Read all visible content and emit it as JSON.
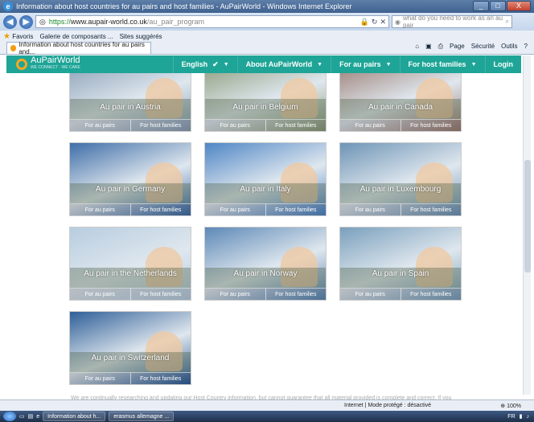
{
  "window": {
    "title": "Information about host countries for au pairs and host families - AuPairWorld - Windows Internet Explorer",
    "buttons": [
      "_",
      "□",
      "X"
    ]
  },
  "addressbar": {
    "https": "https://",
    "host": "www.aupair-world.co.uk",
    "path": "/au_pair_program",
    "search_placeholder": "what do you need to work as an au pair"
  },
  "favorites": {
    "label": "Favoris",
    "items": [
      "Galerie de composants ...",
      "Sites suggérés"
    ]
  },
  "tab": {
    "label": "Information about host countries for au pairs and...",
    "commands": [
      "Page",
      "Sécurité",
      "Outils"
    ]
  },
  "site": {
    "logo_name": "AuPairWorld",
    "logo_tag": "WE CONNECT · WE CARE",
    "nav": [
      {
        "label": "English"
      },
      {
        "label": "About AuPairWorld"
      },
      {
        "label": "For au pairs"
      },
      {
        "label": "For host families"
      },
      {
        "label": "Login"
      }
    ]
  },
  "cards": [
    {
      "title": "Au pair in Austria",
      "left": "For au pairs",
      "right": "For host families",
      "bg": "#8aa0b7"
    },
    {
      "title": "Au pair in Belgium",
      "left": "For au pairs",
      "right": "For host families",
      "bg": "#8b9c7a"
    },
    {
      "title": "Au pair in Canada",
      "left": "For au pairs",
      "right": "For host families",
      "bg": "#9a7c73"
    },
    {
      "title": "Au pair in Germany",
      "left": "For au pairs",
      "right": "For host families",
      "bg": "#3f6ea8"
    },
    {
      "title": "Au pair in Italy",
      "left": "For au pairs",
      "right": "For host families",
      "bg": "#4f86c6"
    },
    {
      "title": "Au pair in Luxembourg",
      "left": "For au pairs",
      "right": "For host families",
      "bg": "#6e94b6"
    },
    {
      "title": "Au pair in the Netherlands",
      "left": "For au pairs",
      "right": "For host families",
      "bg": "#b7cde0"
    },
    {
      "title": "Au pair in Norway",
      "left": "For au pairs",
      "right": "For host families",
      "bg": "#5d89b7"
    },
    {
      "title": "Au pair in Spain",
      "left": "For au pairs",
      "right": "For host families",
      "bg": "#7aa0bd"
    },
    {
      "title": "Au pair in Switzerland",
      "left": "For au pairs",
      "right": "For host families",
      "bg": "#2f5f98"
    }
  ],
  "bottom_text": "We are continually researching and updating our Host Country information, but cannot guarantee that all material provided is complete and correct. If you",
  "status": {
    "zone": "Internet | Mode protégé : désactivé",
    "zoom": "100%"
  },
  "taskbar": {
    "items": [
      "Information about h...",
      "erasmus allemagne ..."
    ],
    "lang": "FR"
  }
}
